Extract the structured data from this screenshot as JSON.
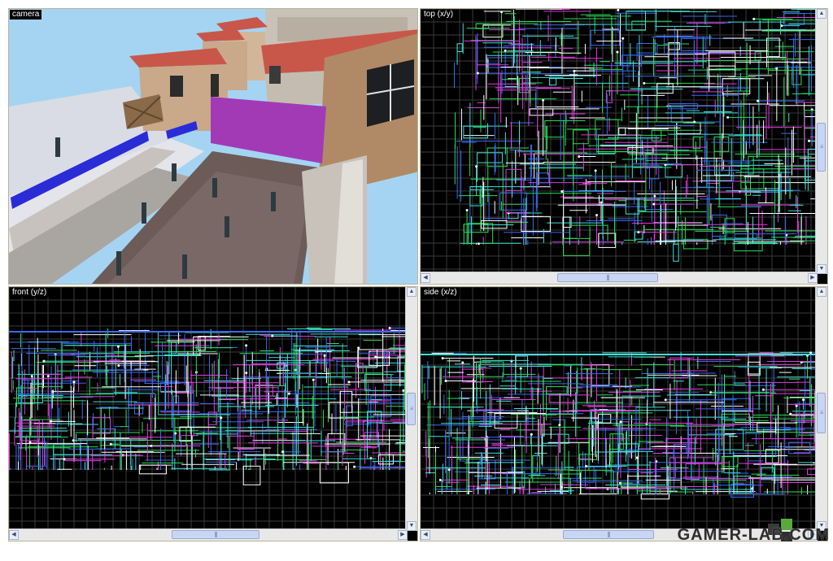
{
  "viewports": {
    "camera": {
      "label": "camera"
    },
    "top": {
      "label": "top (x/y)"
    },
    "front": {
      "label": "front (y/z)"
    },
    "side": {
      "label": "side (x/z)"
    }
  },
  "watermark": {
    "text": "GAMER-LAB.COM"
  },
  "colors": {
    "sky": "#a4d4f2",
    "roof": "#c8574a",
    "wall": "#c9a98a",
    "purple_wall": "#a23ab6",
    "blue_rail": "#2a2cd6",
    "wire_green": "#2bdc5a",
    "wire_cyan": "#3fe0d8",
    "wire_blue": "#3b6cf0",
    "wire_magenta": "#e03ce0",
    "grid": "#3a3a3a"
  },
  "icons": {
    "scroll_up": "triangle-up",
    "scroll_down": "triangle-down",
    "scroll_left": "triangle-left",
    "scroll_right": "triangle-right",
    "watermark_logo": "puzzle-piece"
  }
}
